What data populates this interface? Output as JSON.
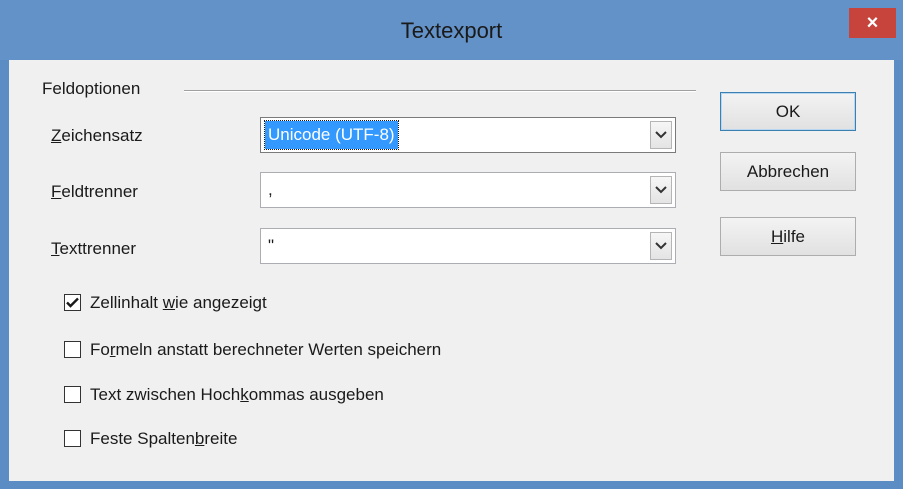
{
  "window": {
    "title": "Textexport",
    "close_glyph": "×"
  },
  "group": {
    "label": "Feldoptionen"
  },
  "fields": {
    "zeichensatz": {
      "label_u": "Z",
      "label_rest": "eichensatz",
      "value": "Unicode (UTF-8)"
    },
    "feldtrenner": {
      "label_u": "F",
      "label_rest": "eldtrenner",
      "value": ","
    },
    "texttrenner": {
      "label_u": "T",
      "label_rest": "exttrenner",
      "value": "\""
    }
  },
  "options": [
    {
      "pre": "Zellinhalt ",
      "u": "w",
      "post": "ie angezeigt",
      "checked": true
    },
    {
      "pre": "Fo",
      "u": "r",
      "post": "meln anstatt berechneter Werten speichern",
      "checked": false
    },
    {
      "pre": "Text zwischen Hoch",
      "u": "k",
      "post": "ommas ausgeben",
      "checked": false
    },
    {
      "pre": "Feste Spalten",
      "u": "b",
      "post": "reite",
      "checked": false
    }
  ],
  "buttons": {
    "ok": "OK",
    "cancel": "Abbrechen",
    "help_u": "H",
    "help_rest": "ilfe"
  },
  "colors": {
    "titlebar": "#6392c8",
    "close": "#c7443d",
    "selection": "#3399ff"
  }
}
